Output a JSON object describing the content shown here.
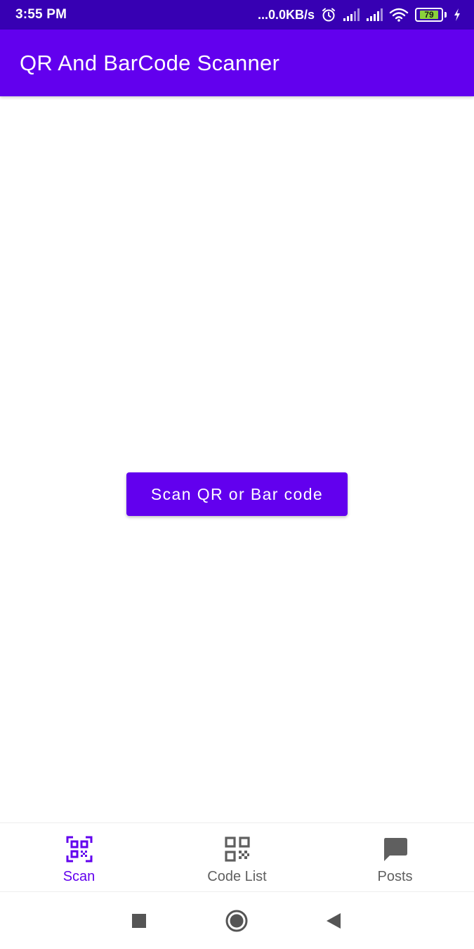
{
  "status_bar": {
    "time": "3:55 PM",
    "net_speed": "...0.0KB/s",
    "battery_level": "79",
    "icons": [
      "alarm-icon",
      "signal-icon",
      "signal-icon",
      "wifi-icon",
      "battery-icon",
      "charging-icon"
    ]
  },
  "app_bar": {
    "title": "QR And BarCode Scanner"
  },
  "main": {
    "scan_button_label": "Scan QR or Bar code"
  },
  "bottom_nav": {
    "items": [
      {
        "label": "Scan",
        "icon": "qr-scan-icon",
        "active": true
      },
      {
        "label": "Code List",
        "icon": "qr-code-icon",
        "active": false
      },
      {
        "label": "Posts",
        "icon": "message-icon",
        "active": false
      }
    ]
  },
  "system_nav": {
    "buttons": [
      "recents-icon",
      "home-icon",
      "back-icon"
    ]
  },
  "colors": {
    "primary": "#6200ee",
    "primary_dark": "#3700b3",
    "inactive": "#5f5f5f"
  }
}
